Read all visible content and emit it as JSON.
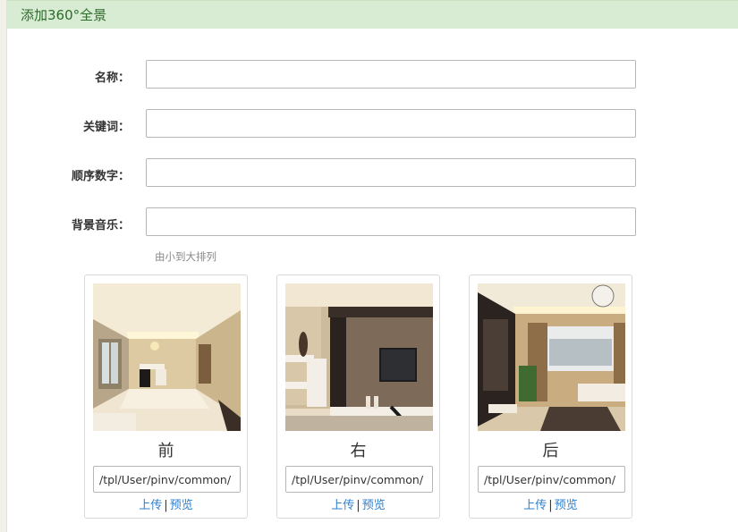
{
  "header": {
    "title": "添加360°全景"
  },
  "form": {
    "name_label": "名称：",
    "keywords_label": "关键词：",
    "order_label": "顺序数字：",
    "music_label": "背景音乐：",
    "order_hint": "由小到大排列"
  },
  "cards": [
    {
      "face": "前",
      "path": "/tpl/User/pinv/common/",
      "upload": "上传",
      "separator": "|",
      "preview": "预览"
    },
    {
      "face": "右",
      "path": "/tpl/User/pinv/common/",
      "upload": "上传",
      "separator": "|",
      "preview": "预览"
    },
    {
      "face": "后",
      "path": "/tpl/User/pinv/common/",
      "upload": "上传",
      "separator": "|",
      "preview": "预览"
    }
  ],
  "colors": {
    "header_bg": "#d7ecd2",
    "header_text": "#2c6a2c",
    "link": "#2f7fcf"
  }
}
